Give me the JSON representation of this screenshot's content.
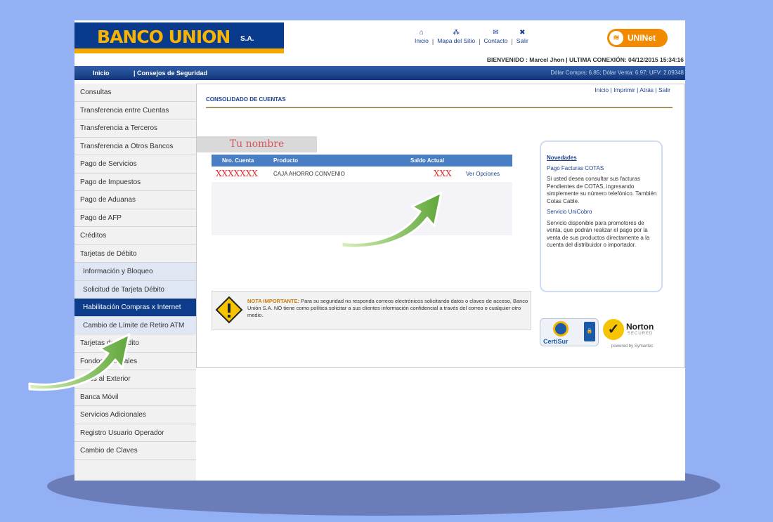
{
  "brand": {
    "name": "BANCO UNION",
    "suffix": "S.A.",
    "product_logo": "UNINet"
  },
  "top_nav": [
    {
      "label": "Inicio",
      "icon": "home-icon"
    },
    {
      "label": "Mapa del Sitio",
      "icon": "sitemap-icon"
    },
    {
      "label": "Contacto",
      "icon": "mail-icon"
    },
    {
      "label": "Salir",
      "icon": "close-icon"
    }
  ],
  "welcome_text": "BIENVENIDO : Marcel Jhon | ULTIMA CONEXIÓN: 04/12/2015 15:34:16",
  "navbar": {
    "home": "Inicio",
    "security": "| Consejos de Seguridad",
    "rates": "Dólar Compra: 6.85; Dólar Venta: 6.97; UFV: 2.09348"
  },
  "sidebar": {
    "items": [
      {
        "label": "Consultas"
      },
      {
        "label": "Transferencia entre Cuentas"
      },
      {
        "label": "Transferencia a Terceros"
      },
      {
        "label": "Transferencia a Otros Bancos"
      },
      {
        "label": "Pago de Servicios"
      },
      {
        "label": "Pago de Impuestos"
      },
      {
        "label": "Pago de Aduanas"
      },
      {
        "label": "Pago de AFP"
      },
      {
        "label": "Créditos"
      },
      {
        "label": "Tarjetas de Débito"
      },
      {
        "label": "Información y Bloqueo"
      },
      {
        "label": "Solicitud de Tarjeta Débito"
      },
      {
        "label": "Habilitación Compras x Internet"
      },
      {
        "label": "Cambio de Límite de Retiro ATM"
      },
      {
        "label": "Tarjetas de Crédito"
      },
      {
        "label": "Fondos Fiduciales"
      },
      {
        "label": "Giros al Exterior"
      },
      {
        "label": "Banca Móvil"
      },
      {
        "label": "Servicios Adicionales"
      },
      {
        "label": "Registro Usuario Operador"
      },
      {
        "label": "Cambio de Claves"
      }
    ]
  },
  "content": {
    "links": "Inicio | Imprimir | Atrás | Salir",
    "title": "CONSOLIDADO DE CUENTAS",
    "your_name": "Tu nombre",
    "table": {
      "headers": [
        "Nro. Cuenta",
        "Producto",
        "Saldo Actual"
      ],
      "rows": [
        {
          "account": "XXXXXXX",
          "product": "CAJA AHORRO CONVENIO",
          "balance": "XXX",
          "action": "Ver Opciones"
        }
      ]
    },
    "notice": {
      "label": "NOTA IMPORTANTE:",
      "text": "Para su seguridad no responda correos electrónicos solicitando datos o claves de acceso, Banco Unión S.A. NO tiene como política solicitar a sus clientes información confidencial a través del correo o cualquier otro medio."
    }
  },
  "news": {
    "title": "Novedades",
    "item1_title": "Pago Facturas COTAS",
    "item1_text": "Si usted desea consultar sus facturas Pendientes de COTAS, ingresando simplemente su número telefónico. También Cotas Cable.",
    "item2_title": "Servicio UniCobro",
    "item2_text": "Servicio disponible para promotores de venta, que podrán realizar el pago por la venta de sus productos directamente a la cuenta del distribuidor o importador."
  },
  "badges": {
    "certisur": "CertiSur",
    "norton": "Norton",
    "norton_secured": "SECURED",
    "norton_powered": "powered by Symantec"
  }
}
